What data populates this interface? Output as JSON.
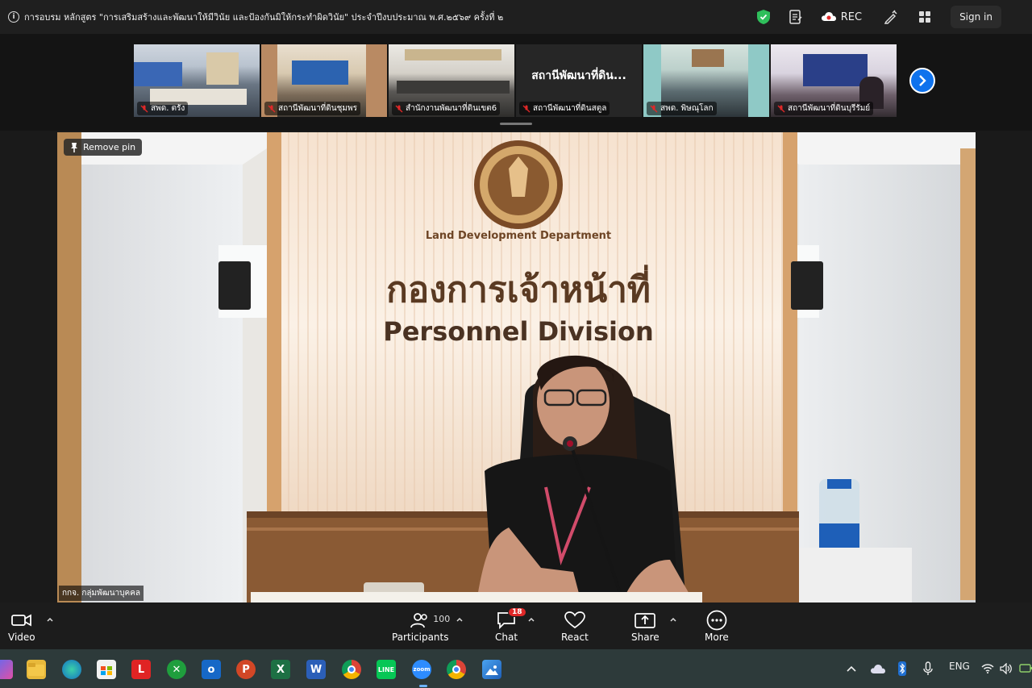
{
  "meeting": {
    "title": "การอบรม หลักสูตร \"การเสริมสร้างและพัฒนาให้มีวินัย และป้องกันมิให้กระทำผิดวินัย\" ประจำปีงบประมาณ พ.ศ.๒๕๖๙ ครั้งที่ ๒"
  },
  "topbar": {
    "rec_label": "REC",
    "signin_label": "Sign in",
    "security_color": "#2fbf5b"
  },
  "gallery": {
    "thumbnails": [
      {
        "label": "สพด. ตรัง"
      },
      {
        "label": "สถานีพัฒนาที่ดินชุมพร"
      },
      {
        "label": "สำนักงานพัฒนาที่ดินเขต6"
      },
      {
        "label": "สถานีพัฒนาที่ดินสตูล",
        "display_name": "สถานีพัฒนาที่ดิน..."
      },
      {
        "label": "สพด. พิษณุโลก"
      },
      {
        "label": "สถานีพัฒนาที่ดินบุรีรัมย์"
      }
    ]
  },
  "main_video": {
    "remove_pin_label": "Remove pin",
    "speaker_name": "กกจ. กลุ่มพัฒนาบุคคล",
    "wall_text_thai": "กองการเจ้าหน้าที่",
    "wall_text_english": "Personnel Division",
    "emblem_text": "Land Development Department"
  },
  "controls": {
    "video_label": "Video",
    "participants_label": "Participants",
    "participants_count": "100",
    "chat_label": "Chat",
    "chat_badge": "18",
    "react_label": "React",
    "share_label": "Share",
    "more_label": "More"
  },
  "taskbar": {
    "apps": [
      "copilot-icon",
      "file-explorer-icon",
      "edge-icon",
      "store-icon",
      "l-app-icon",
      "xbox-icon",
      "outlook-icon",
      "powerpoint-icon",
      "excel-icon",
      "word-icon",
      "chrome-icon",
      "line-icon",
      "zoom-icon",
      "chrome-profile-icon",
      "photos-icon"
    ],
    "language": "ENG"
  }
}
